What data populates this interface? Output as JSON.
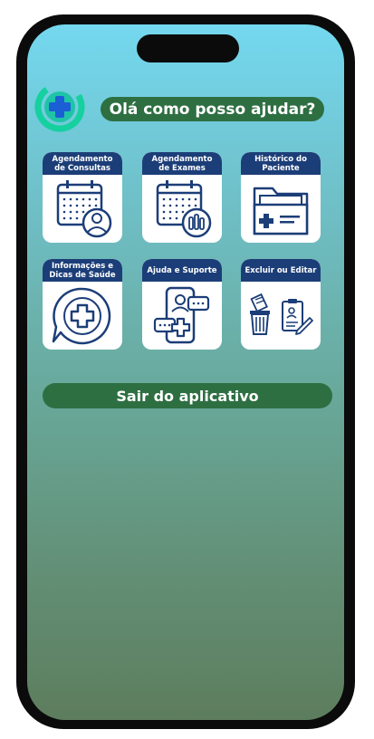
{
  "greeting": "Olá como posso ajudar?",
  "cards": [
    {
      "label": "Agendamento\nde Consultas",
      "icon": "calendar-doctor-icon"
    },
    {
      "label": "Agendamento\nde Exames",
      "icon": "calendar-exam-icon"
    },
    {
      "label": "Histórico do\nPaciente",
      "icon": "folder-medical-icon"
    },
    {
      "label": "Informações e\nDicas de Saúde",
      "icon": "health-chat-icon"
    },
    {
      "label": "Ajuda e Suporte",
      "icon": "phone-support-icon"
    },
    {
      "label": "Excluir ou Editar",
      "icon": "delete-edit-icon"
    }
  ],
  "exit_button": "Sair do aplicativo",
  "colors": {
    "header_blue": "#1c3e78",
    "button_green": "#2e6f42",
    "logo_teal": "#16d0a0",
    "logo_blue": "#1b5fd6",
    "icon_blue": "#1c3e78"
  }
}
